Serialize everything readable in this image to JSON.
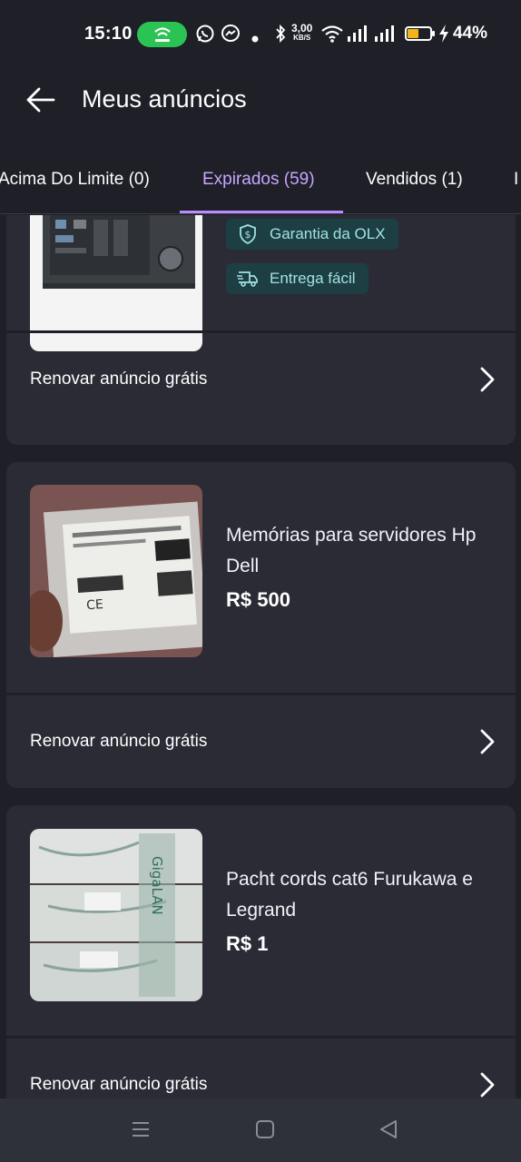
{
  "status_bar": {
    "time": "15:10",
    "speed_value": "3,00",
    "speed_unit": "KB/S",
    "battery": "44%",
    "icons": [
      "hotspot-icon",
      "whatsapp-icon",
      "messenger-icon",
      "dot-icon",
      "bluetooth-icon",
      "wifi-icon",
      "signal-icon",
      "signal-icon-2",
      "battery-icon",
      "charging-icon"
    ]
  },
  "header": {
    "title": "Meus anúncios"
  },
  "tabs": [
    {
      "label": "Acima Do Limite (0)"
    },
    {
      "label": "Expirados (59)"
    },
    {
      "label": "Vendidos (1)"
    },
    {
      "label": "I"
    }
  ],
  "colors": {
    "accent": "#b98cff",
    "background": "#1e1f27",
    "card": "#2a2b35",
    "badge": "#1d3e43"
  },
  "listings": [
    {
      "badges": [
        "Garantia da OLX",
        "Entrega fácil"
      ],
      "renew_label": "Renovar anúncio grátis"
    },
    {
      "title": "Memórias para servidores Hp Dell",
      "price": "R$ 500",
      "renew_label": "Renovar anúncio grátis"
    },
    {
      "title": "Pacht cords cat6 Furukawa e Legrand",
      "price": "R$ 1",
      "renew_label": "Renovar anúncio grátis"
    }
  ],
  "nav_bar": {
    "icons": [
      "menu-icon",
      "home-icon",
      "back-triangle-icon"
    ]
  }
}
